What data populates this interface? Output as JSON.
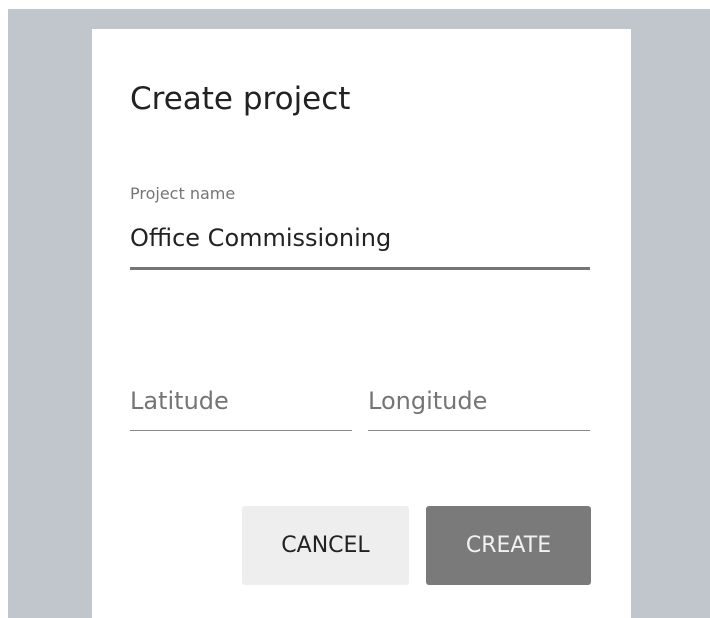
{
  "dialog": {
    "title": "Create project",
    "project_name": {
      "label": "Project name",
      "value": "Office Commissioning"
    },
    "latitude": {
      "placeholder": "Latitude",
      "value": ""
    },
    "longitude": {
      "placeholder": "Longitude",
      "value": ""
    },
    "buttons": {
      "cancel_label": "CANCEL",
      "create_label": "CREATE"
    }
  },
  "colors": {
    "backdrop": "#c1c5cc",
    "dialog_background": "#ffffff",
    "create_button": "#7a7a7a",
    "cancel_button": "#eeeeee"
  }
}
